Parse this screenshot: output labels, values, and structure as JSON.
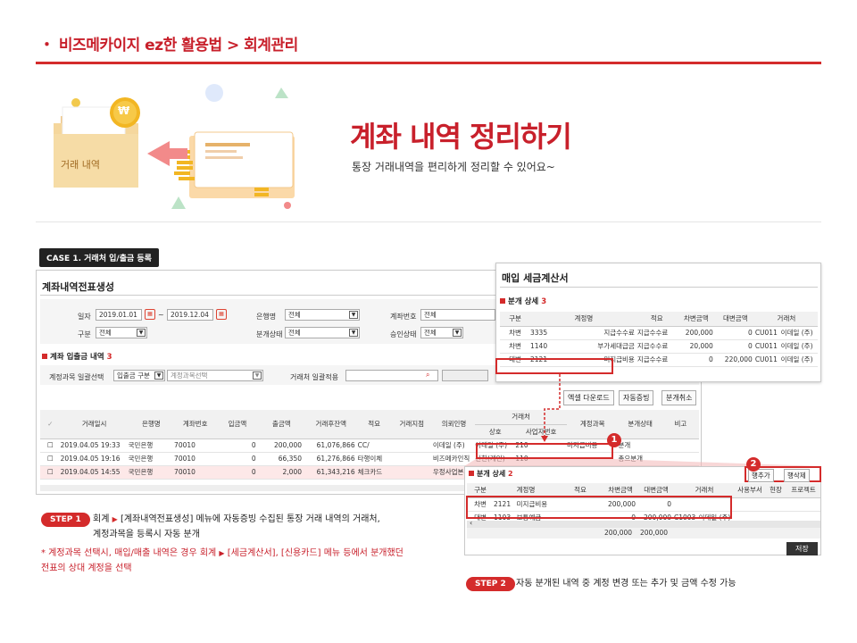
{
  "breadcrumb": "・ 비즈메카이지 ez한 활용법 > 회계관리",
  "hero": {
    "title": "계좌 내역 정리하기",
    "subtitle": "통장 거래내역을 편리하게 정리할 수 있어요~",
    "folder_label": "거래 내역",
    "coin_symbol": "₩"
  },
  "case_label": "CASE 1. 거래처 입/출금 등록",
  "main": {
    "title": "계좌내역전표생성",
    "date_label": "일자",
    "date_from": "2019.01.01",
    "date_to": "2019.12.04",
    "bank_label": "은행명",
    "bank_value": "전체",
    "account_label": "계좌번호",
    "account_value": "전체",
    "type_label": "구분",
    "type_value": "전체",
    "split_label": "분개상태",
    "split_value": "전체",
    "approve_label": "승인상태",
    "approve_value": "전체",
    "section": "계좌 입출금 내역",
    "section_count": "3",
    "bulk_label": "계정과목 일괄선택",
    "bulk_select": "입출금 구분",
    "bulk_placeholder": "계정과목선택",
    "vendor_bulk_label": "거래처 일괄적용",
    "buttons": [
      "엑셀 다운로드",
      "자동증빙",
      "분개취소"
    ],
    "headers": [
      "거래일시",
      "은행명",
      "계좌번호",
      "입금액",
      "출금액",
      "거래후잔액",
      "적요",
      "거래지점",
      "의뢰인명",
      "상호",
      "사업자번호",
      "계정과목",
      "분개상태",
      "비고"
    ],
    "vendor_header": "거래처",
    "rows": [
      [
        "2019.04.05 19:33",
        "국민은행",
        "70010",
        "0",
        "200,000",
        "61,076,866",
        "CC/",
        "",
        "이데일 (주)",
        "이데일 (주)",
        "210",
        "미지급비용",
        "분개"
      ],
      [
        "2019.04.05 19:16",
        "국민은행",
        "70010",
        "0",
        "66,350",
        "61,276,866",
        "타행이체",
        "",
        "비즈메카인직",
        "신한(개인)",
        "110",
        "",
        "총으분개"
      ],
      [
        "2019.04.05 14:55",
        "국민은행",
        "70010",
        "0",
        "2,000",
        "61,343,216",
        "체크카드",
        "",
        "우정사업본부",
        "",
        "",
        "",
        ""
      ]
    ]
  },
  "tax": {
    "title": "매입 세금계산서",
    "section": "분개 상세",
    "section_count": "3",
    "headers": [
      "구분",
      "계정명",
      "적요",
      "차변금액",
      "대변금액",
      "거래처"
    ],
    "rows": [
      [
        "차변",
        "3335",
        "지급수수료",
        "지급수수료",
        "200,000",
        "0",
        "CU011",
        "이데일 (주)"
      ],
      [
        "차변",
        "1140",
        "부가세대급금",
        "지급수수료",
        "20,000",
        "0",
        "CU011",
        "이데일 (주)"
      ],
      [
        "대변",
        "2121",
        "미지급비용",
        "지급수수료",
        "0",
        "220,000",
        "CU011",
        "이데일 (주)"
      ]
    ]
  },
  "split": {
    "section": "분개 상세",
    "section_count": "2",
    "add_button": "행추가",
    "del_button": "행삭제",
    "headers": [
      "구분",
      "계정명",
      "적요",
      "차변금액",
      "대변금액",
      "거래처",
      "사용부서",
      "현장",
      "프로젝트"
    ],
    "rows": [
      [
        "차변",
        "2121",
        "미지급비용",
        "",
        "200,000",
        "0",
        "",
        ""
      ],
      [
        "대변",
        "1103",
        "보통예금",
        "",
        "0",
        "200,000",
        "C1003",
        "이데일 (주)"
      ]
    ],
    "total_debit": "200,000",
    "total_credit": "200,000",
    "save_button": "저장"
  },
  "markers": [
    "1",
    "2"
  ],
  "steps": {
    "step1_label": "STEP 1",
    "step1_line1_a": "회계",
    "step1_line1_b": "[계좌내역전표생성] 메뉴에 자동증빙 수집된 통장 거래 내역의 거래처,",
    "step1_line2": "계정과목을 등록시 자동 분개",
    "note_line1_a": "* 계정과목 선택시, 매입/매출 내역은 경우 회계",
    "note_line1_b": "[세금계산서], [신용카드] 메뉴 등에서 분개했던",
    "note_line2": "전표의  상대 계정을 선택",
    "step2_label": "STEP 2",
    "step2_text": "자동 분개된 내역 중 계정 변경 또는 추가 및 금액 수정 가능"
  },
  "colors": {
    "accent": "#d42b2b"
  }
}
